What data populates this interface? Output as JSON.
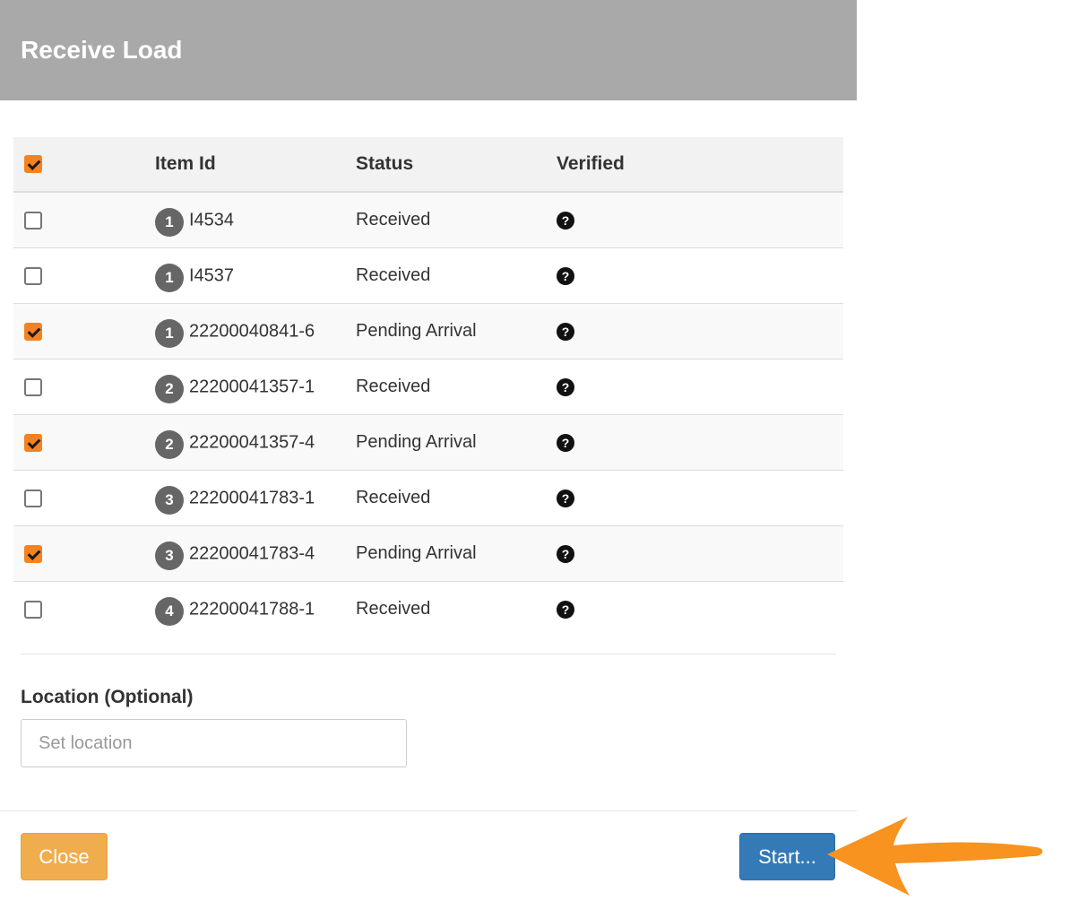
{
  "modal": {
    "title": "Receive Load"
  },
  "table": {
    "headers": {
      "item_id": "Item Id",
      "status": "Status",
      "verified": "Verified"
    },
    "select_all_checked": true,
    "rows": [
      {
        "checked": false,
        "group": "1",
        "item_id": "I4534",
        "status": "Received",
        "verified_icon": "question-circle-icon"
      },
      {
        "checked": false,
        "group": "1",
        "item_id": "I4537",
        "status": "Received",
        "verified_icon": "question-circle-icon"
      },
      {
        "checked": true,
        "group": "1",
        "item_id": "22200040841-6",
        "status": "Pending Arrival",
        "verified_icon": "question-circle-icon"
      },
      {
        "checked": false,
        "group": "2",
        "item_id": "22200041357-1",
        "status": "Received",
        "verified_icon": "question-circle-icon"
      },
      {
        "checked": true,
        "group": "2",
        "item_id": "22200041357-4",
        "status": "Pending Arrival",
        "verified_icon": "question-circle-icon"
      },
      {
        "checked": false,
        "group": "3",
        "item_id": "22200041783-1",
        "status": "Received",
        "verified_icon": "question-circle-icon"
      },
      {
        "checked": true,
        "group": "3",
        "item_id": "22200041783-4",
        "status": "Pending Arrival",
        "verified_icon": "question-circle-icon"
      },
      {
        "checked": false,
        "group": "4",
        "item_id": "22200041788-1",
        "status": "Received",
        "verified_icon": "question-circle-icon"
      }
    ]
  },
  "location": {
    "label": "Location (Optional)",
    "placeholder": "Set location",
    "value": ""
  },
  "footer": {
    "close_label": "Close",
    "start_label": "Start..."
  },
  "colors": {
    "header_bg": "#a9a9a9",
    "checkbox_checked": "#f58220",
    "close_button": "#f0ad4e",
    "start_button": "#337ab7",
    "arrow": "#f7931e"
  }
}
